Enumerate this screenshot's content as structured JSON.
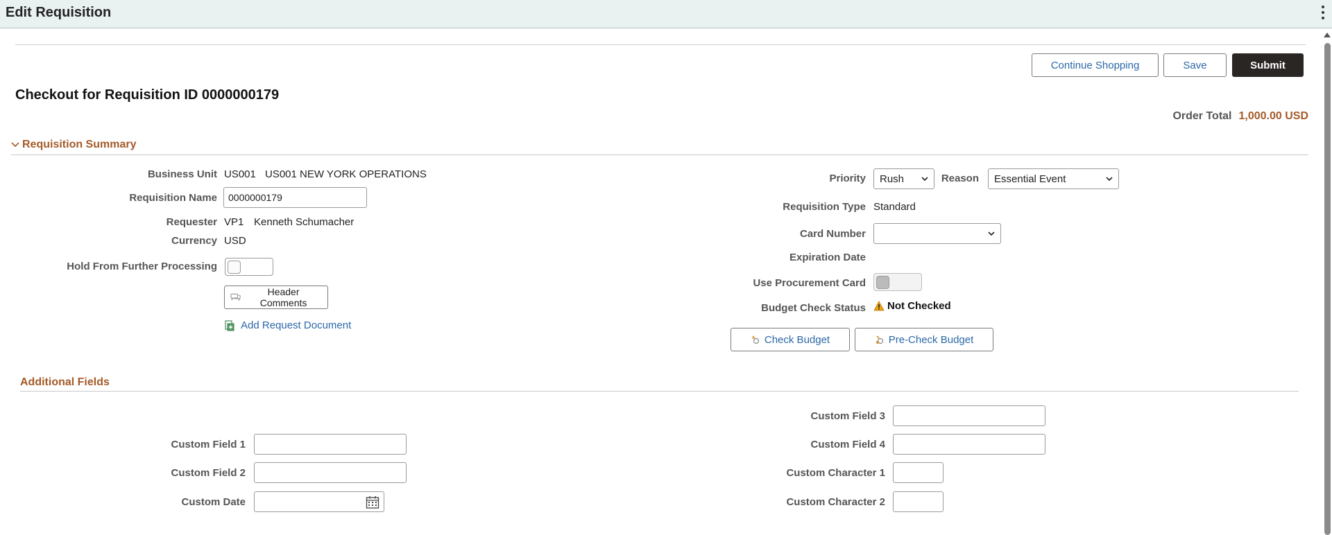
{
  "header": {
    "title": "Edit Requisition"
  },
  "actions": {
    "continue_shopping": "Continue Shopping",
    "save": "Save",
    "submit": "Submit"
  },
  "page_title": "Checkout for Requisition ID 0000000179",
  "order_total": {
    "label": "Order Total",
    "value": "1,000.00 USD"
  },
  "summary": {
    "section_title": "Requisition Summary",
    "business_unit": {
      "label": "Business Unit",
      "code": "US001",
      "name": "US001 NEW YORK OPERATIONS"
    },
    "requisition_name": {
      "label": "Requisition Name",
      "value": "0000000179"
    },
    "requester": {
      "label": "Requester",
      "code": "VP1",
      "name": "Kenneth Schumacher"
    },
    "currency": {
      "label": "Currency",
      "value": "USD"
    },
    "hold": {
      "label": "Hold From Further Processing"
    },
    "header_comments": "Header Comments",
    "add_request_document": "Add Request Document",
    "priority": {
      "label": "Priority",
      "value": "Rush"
    },
    "reason": {
      "label": "Reason",
      "value": "Essential Event"
    },
    "requisition_type": {
      "label": "Requisition Type",
      "value": "Standard"
    },
    "card_number": {
      "label": "Card Number",
      "value": ""
    },
    "expiration_date": {
      "label": "Expiration Date"
    },
    "use_procurement_card": {
      "label": "Use Procurement Card"
    },
    "budget_check_status": {
      "label": "Budget Check Status",
      "value": "Not Checked"
    },
    "check_budget": "Check Budget",
    "pre_check_budget": "Pre-Check Budget"
  },
  "additional": {
    "section_title": "Additional Fields",
    "custom_field_1": {
      "label": "Custom Field 1",
      "value": ""
    },
    "custom_field_2": {
      "label": "Custom Field 2",
      "value": ""
    },
    "custom_date": {
      "label": "Custom Date",
      "value": ""
    },
    "custom_field_3": {
      "label": "Custom Field 3",
      "value": ""
    },
    "custom_field_4": {
      "label": "Custom Field 4",
      "value": ""
    },
    "custom_character_1": {
      "label": "Custom Character 1",
      "value": ""
    },
    "custom_character_2": {
      "label": "Custom Character 2",
      "value": ""
    }
  },
  "colors": {
    "accent": "#a45a28",
    "link": "#2a68a8",
    "primary_button": "#2a2624",
    "header_bg": "#eaf1f1"
  },
  "icons": [
    "kebab-menu-icon",
    "chevron-down-icon",
    "comments-icon",
    "add-document-icon",
    "warning-icon",
    "check-budget-icon",
    "calendar-icon"
  ]
}
